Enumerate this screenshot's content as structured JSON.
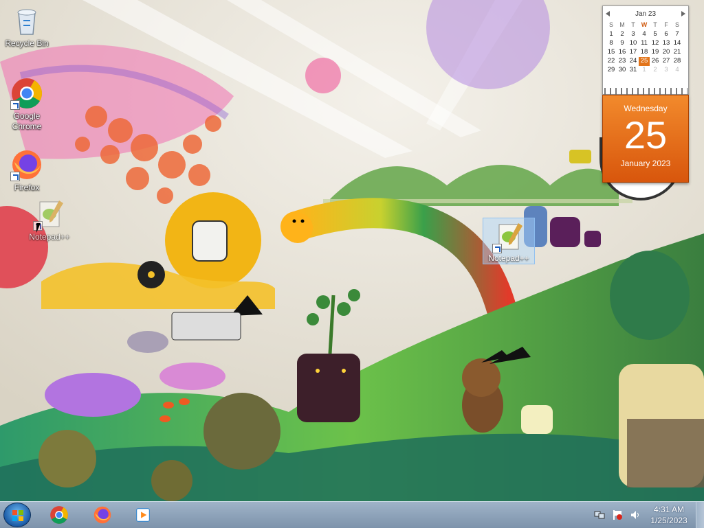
{
  "desktop": {
    "icons": [
      {
        "label": "Recycle Bin",
        "icon": "recycle-bin-icon"
      },
      {
        "label": "Google Chrome",
        "icon": "chrome-icon"
      },
      {
        "label": "Firefox",
        "icon": "firefox-icon"
      },
      {
        "label": "Notepad++",
        "icon": "notepadpp-icon"
      }
    ],
    "selected_icon": {
      "label": "Notepad++",
      "icon": "notepadpp-icon"
    }
  },
  "calendar_gadget": {
    "month_label": "Jan 23",
    "weekdays": [
      "S",
      "M",
      "T",
      "W",
      "T",
      "F",
      "S"
    ],
    "weeks": [
      [
        "1",
        "2",
        "3",
        "4",
        "5",
        "6",
        "7"
      ],
      [
        "8",
        "9",
        "10",
        "11",
        "12",
        "13",
        "14"
      ],
      [
        "15",
        "16",
        "17",
        "18",
        "19",
        "20",
        "21"
      ],
      [
        "22",
        "23",
        "24",
        "25",
        "26",
        "27",
        "28"
      ],
      [
        "29",
        "30",
        "31",
        "1",
        "2",
        "3",
        "4"
      ]
    ],
    "today": "25",
    "weekday_name": "Wednesday",
    "day_number": "25",
    "month_year": "January 2023",
    "accent": "#e2741a"
  },
  "taskbar": {
    "start_icon": "windows-start-icon",
    "pinned": [
      {
        "name": "chrome",
        "icon": "chrome-icon"
      },
      {
        "name": "firefox",
        "icon": "firefox-icon"
      },
      {
        "name": "media-player",
        "icon": "media-player-icon"
      }
    ],
    "tray_icons": [
      "network-icon",
      "action-center-flag-icon",
      "volume-icon"
    ],
    "time": "4:31 AM",
    "date": "1/25/2023"
  }
}
